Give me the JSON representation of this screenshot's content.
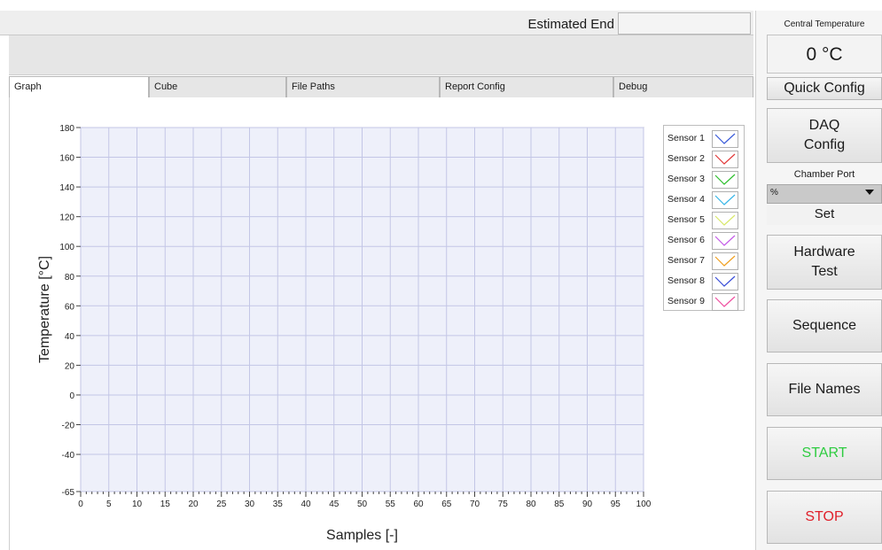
{
  "header": {
    "estimated_end_label": "Estimated End",
    "estimated_end_value": ""
  },
  "tabs": [
    {
      "label": "Graph",
      "active": true
    },
    {
      "label": "Cube",
      "active": false
    },
    {
      "label": "File Paths",
      "active": false
    },
    {
      "label": "Report Config",
      "active": false
    },
    {
      "label": "Debug",
      "active": false
    }
  ],
  "chart_data": {
    "type": "line",
    "xlabel": "Samples [-]",
    "ylabel": "Temperature [°C]",
    "xlim": [
      0,
      100
    ],
    "ylim": [
      -65,
      180
    ],
    "x_ticks": [
      0,
      5,
      10,
      15,
      20,
      25,
      30,
      35,
      40,
      45,
      50,
      55,
      60,
      65,
      70,
      75,
      80,
      85,
      90,
      95,
      100
    ],
    "y_ticks": [
      -65,
      -40,
      -20,
      0,
      20,
      40,
      60,
      80,
      100,
      120,
      140,
      160,
      180
    ],
    "grid": true,
    "legend_placement": "right",
    "series": [
      {
        "name": "Sensor 1",
        "color": "#3a5bd9",
        "values": []
      },
      {
        "name": "Sensor 2",
        "color": "#e23a3a",
        "values": []
      },
      {
        "name": "Sensor 3",
        "color": "#2fbf2f",
        "values": []
      },
      {
        "name": "Sensor 4",
        "color": "#38b6e8",
        "values": []
      },
      {
        "name": "Sensor 5",
        "color": "#d8e86a",
        "values": []
      },
      {
        "name": "Sensor 6",
        "color": "#c45be8",
        "values": []
      },
      {
        "name": "Sensor 7",
        "color": "#f0a020",
        "values": []
      },
      {
        "name": "Sensor 8",
        "color": "#3a4fd9",
        "values": []
      },
      {
        "name": "Sensor 9",
        "color": "#ef4fa0",
        "values": []
      }
    ]
  },
  "sidebar": {
    "central_temperature_label": "Central Temperature",
    "central_temperature_value": "0 °C",
    "quick_config": "Quick Config",
    "daq_config_line1": "DAQ",
    "daq_config_line2": "Config",
    "chamber_port_label": "Chamber Port",
    "chamber_port_value": "%",
    "set": "Set",
    "hardware_test_line1": "Hardware",
    "hardware_test_line2": "Test",
    "sequence": "Sequence",
    "file_names": "File Names",
    "start": "START",
    "stop": "STOP",
    "start_color": "#2ecc40",
    "stop_color": "#e0202a"
  }
}
